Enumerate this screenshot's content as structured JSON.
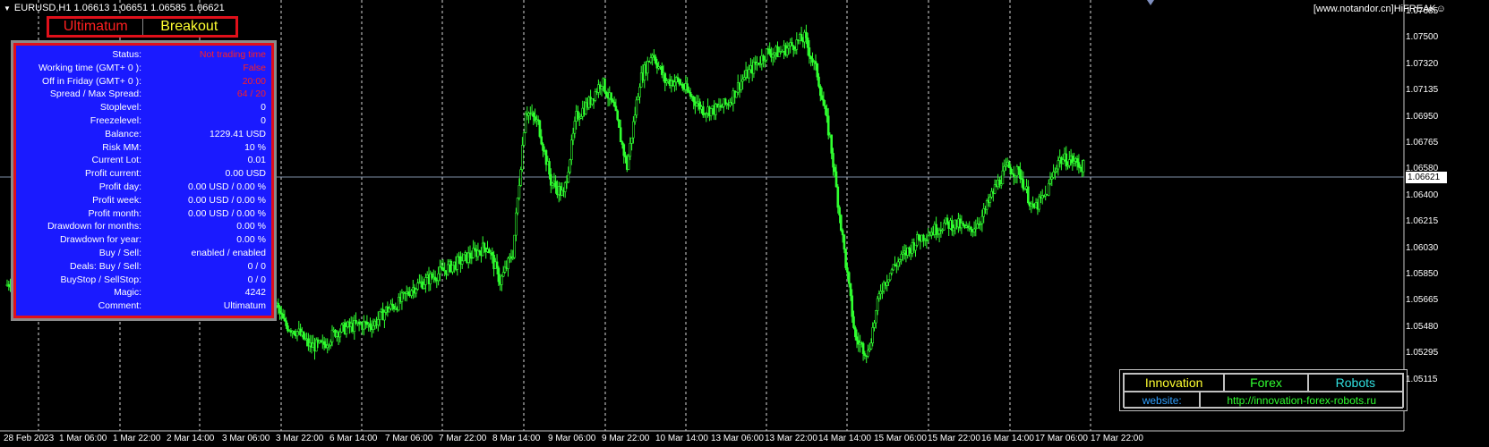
{
  "chart_header": {
    "symbol_line": "EURUSD,H1  1.06613 1.06651 1.06585 1.06621",
    "watermark": "[www.notandor.cn]HiFREAK☺"
  },
  "tabs": [
    {
      "label": "Ultimatum",
      "color": "#ff2020"
    },
    {
      "label": "Breakout",
      "color": "#ffff30"
    }
  ],
  "status_panel": {
    "rows": [
      {
        "label": "Status:",
        "value": "Not trading time",
        "alert": true
      },
      {
        "label": "Working time (GMT+ 0 ):",
        "value": "False",
        "alert": true
      },
      {
        "label": "Off in Friday (GMT+ 0 ):",
        "value": "20:00",
        "alert": true
      },
      {
        "label": "Spread / Max Spread:",
        "value": "64 / 20",
        "alert": true
      },
      {
        "label": "Stoplevel:",
        "value": "0",
        "alert": false
      },
      {
        "label": "Freezelevel:",
        "value": "0",
        "alert": false
      },
      {
        "label": "Balance:",
        "value": "1229.41 USD",
        "alert": false
      },
      {
        "label": "Risk MM:",
        "value": "10 %",
        "alert": false
      },
      {
        "label": "Current Lot:",
        "value": "0.01",
        "alert": false
      },
      {
        "label": "Profit current:",
        "value": "0.00 USD",
        "alert": false
      },
      {
        "label": "Profit day:",
        "value": "0.00 USD / 0.00 %",
        "alert": false
      },
      {
        "label": "Profit week:",
        "value": "0.00 USD / 0.00 %",
        "alert": false
      },
      {
        "label": "Profit month:",
        "value": "0.00 USD / 0.00 %",
        "alert": false
      },
      {
        "label": "Drawdown for months:",
        "value": "0.00 %",
        "alert": false
      },
      {
        "label": "Drawdown for year:",
        "value": "0.00 %",
        "alert": false
      },
      {
        "label": "Buy  /  Sell:",
        "value": "enabled  /  enabled",
        "alert": false
      },
      {
        "label": "Deals: Buy / Sell:",
        "value": "0  /  0",
        "alert": false
      },
      {
        "label": "BuyStop / SellStop:",
        "value": "0  /  0",
        "alert": false
      },
      {
        "label": "Magic:",
        "value": "4242",
        "alert": false
      },
      {
        "label": "Comment:",
        "value": "Ultimatum",
        "alert": false
      }
    ]
  },
  "info_box": {
    "top": [
      {
        "text": "Innovation",
        "color": "#ffff30"
      },
      {
        "text": "Forex",
        "color": "#30ff30"
      },
      {
        "text": "Robots",
        "color": "#30e0e0"
      }
    ],
    "website_label": "website:",
    "website_url": "http://innovation-forex-robots.ru",
    "website_label_color": "#30a0ff",
    "website_url_color": "#30ff30"
  },
  "price_axis": {
    "labels": [
      "1.07685",
      "1.07500",
      "1.07320",
      "1.07135",
      "1.06950",
      "1.06765",
      "1.06580",
      "1.06400",
      "1.06215",
      "1.06030",
      "1.05850",
      "1.05665",
      "1.05480",
      "1.05295",
      "1.05115"
    ],
    "current_price": "1.06621"
  },
  "time_axis": {
    "labels": [
      "28 Feb 2023",
      "1 Mar 06:00",
      "1 Mar 22:00",
      "2 Mar 14:00",
      "3 Mar 06:00",
      "3 Mar 22:00",
      "6 Mar 14:00",
      "7 Mar 06:00",
      "7 Mar 22:00",
      "8 Mar 14:00",
      "9 Mar 06:00",
      "9 Mar 22:00",
      "10 Mar 14:00",
      "13 Mar 06:00",
      "13 Mar 22:00",
      "14 Mar 14:00",
      "15 Mar 06:00",
      "15 Mar 22:00",
      "16 Mar 14:00",
      "17 Mar 06:00",
      "17 Mar 22:00"
    ]
  },
  "chart_data": {
    "type": "line",
    "series": [
      {
        "values": [
          1.0577,
          1.0585,
          1.061,
          1.0623,
          1.0625,
          1.063,
          1.0625,
          1.064,
          1.0652,
          1.0648,
          1.064,
          1.064,
          1.066,
          1.0695,
          1.0685,
          1.0685,
          1.0693,
          1.069,
          1.068,
          1.066,
          1.0615,
          1.057,
          1.055,
          1.0545,
          1.0535,
          1.0535,
          1.0545,
          1.0548,
          1.055,
          1.055,
          1.056,
          1.0565,
          1.0575,
          1.058,
          1.0585,
          1.059,
          1.0595,
          1.06,
          1.0605,
          1.058,
          1.06,
          1.07,
          1.069,
          1.065,
          1.064,
          1.0695,
          1.0705,
          1.072,
          1.07,
          1.066,
          1.072,
          1.074,
          1.072,
          1.072,
          1.071,
          1.07,
          1.07,
          1.0705,
          1.072,
          1.073,
          1.074,
          1.074,
          1.0745,
          1.075,
          1.0725,
          1.068,
          1.061,
          1.054,
          1.053,
          1.0575,
          1.059,
          1.06,
          1.061,
          1.0615,
          1.062,
          1.062,
          1.0615,
          1.0625,
          1.0645,
          1.066,
          1.0655,
          1.063,
          1.064,
          1.0665,
          1.0665,
          1.066
        ]
      }
    ]
  }
}
